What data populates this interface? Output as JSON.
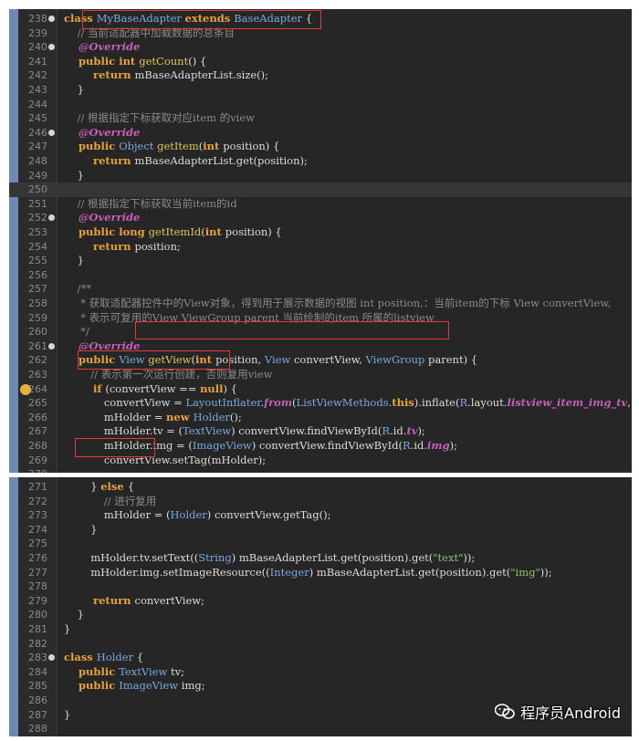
{
  "watermark": {
    "text": "程序员Android",
    "icon": "wechat-icon"
  },
  "editor1": {
    "lines": [
      {
        "n": "238",
        "fold": true,
        "segs": [
          [
            "k",
            "class "
          ],
          [
            "t",
            "MyBaseAdapter "
          ],
          [
            "k",
            "extends "
          ],
          [
            "t",
            "BaseAdapter "
          ],
          [
            "",
            "{"
          ]
        ]
      },
      {
        "n": "239",
        "segs": [
          [
            "c",
            "    // 当前适配器中加载数据的总条目"
          ]
        ]
      },
      {
        "n": "240",
        "fold": true,
        "segs": [
          [
            "a",
            "    @Override"
          ]
        ]
      },
      {
        "n": "241",
        "segs": [
          [
            "k",
            "    public int "
          ],
          [
            "m",
            "getCount"
          ],
          [
            "",
            "() {"
          ]
        ]
      },
      {
        "n": "242",
        "segs": [
          [
            "k",
            "        return "
          ],
          [
            "",
            "mBaseAdapterList.size();"
          ]
        ]
      },
      {
        "n": "243",
        "segs": [
          [
            "",
            "    }"
          ]
        ]
      },
      {
        "n": "244",
        "segs": [
          [
            "",
            ""
          ]
        ]
      },
      {
        "n": "245",
        "segs": [
          [
            "c",
            "    // 根据指定下标获取对应item 的view"
          ]
        ]
      },
      {
        "n": "246",
        "fold": true,
        "segs": [
          [
            "a",
            "    @Override"
          ]
        ]
      },
      {
        "n": "247",
        "segs": [
          [
            "k",
            "    public "
          ],
          [
            "t",
            "Object "
          ],
          [
            "m",
            "getItem"
          ],
          [
            "",
            "("
          ],
          [
            "k",
            "int "
          ],
          [
            "",
            "position) {"
          ]
        ]
      },
      {
        "n": "248",
        "segs": [
          [
            "k",
            "        return "
          ],
          [
            "",
            "mBaseAdapterList.get(position);"
          ]
        ]
      },
      {
        "n": "249",
        "segs": [
          [
            "",
            "    }"
          ]
        ]
      },
      {
        "n": "250",
        "hl": true,
        "segs": [
          [
            "",
            ""
          ]
        ]
      },
      {
        "n": "251",
        "segs": [
          [
            "c",
            "    // 根据指定下标获取当前item的id"
          ]
        ]
      },
      {
        "n": "252",
        "fold": true,
        "segs": [
          [
            "a",
            "    @Override"
          ]
        ]
      },
      {
        "n": "253",
        "segs": [
          [
            "k",
            "    public long "
          ],
          [
            "m",
            "getItemId"
          ],
          [
            "",
            "("
          ],
          [
            "k",
            "int "
          ],
          [
            "",
            "position) {"
          ]
        ]
      },
      {
        "n": "254",
        "segs": [
          [
            "k",
            "        return "
          ],
          [
            "",
            "position;"
          ]
        ]
      },
      {
        "n": "255",
        "segs": [
          [
            "",
            "    }"
          ]
        ]
      },
      {
        "n": "256",
        "segs": [
          [
            "",
            ""
          ]
        ]
      },
      {
        "n": "257",
        "segs": [
          [
            "c",
            "    /**"
          ]
        ]
      },
      {
        "n": "258",
        "segs": [
          [
            "c",
            "     * 获取适配器控件中的View对象，得到用于展示数据的视图 int position,：当前item的下标 View convertView,"
          ]
        ]
      },
      {
        "n": "259",
        "segs": [
          [
            "c",
            "     * 表示可复用的View ViewGroup parent 当前绘制的item 所属的listview"
          ]
        ]
      },
      {
        "n": "260",
        "segs": [
          [
            "c",
            "     */"
          ]
        ]
      },
      {
        "n": "261",
        "fold": true,
        "segs": [
          [
            "a",
            "    @Override"
          ]
        ]
      },
      {
        "n": "262",
        "segs": [
          [
            "k",
            "    public "
          ],
          [
            "t",
            "View "
          ],
          [
            "m",
            "getView"
          ],
          [
            "",
            "("
          ],
          [
            "k",
            "int "
          ],
          [
            "",
            "position, "
          ],
          [
            "t",
            "View "
          ],
          [
            "",
            "convertView, "
          ],
          [
            "t",
            "ViewGroup "
          ],
          [
            "",
            "parent) {"
          ]
        ]
      },
      {
        "n": "263",
        "segs": [
          [
            "c",
            "        // 表示第一次运行创建，否则复用view"
          ]
        ]
      },
      {
        "n": "264",
        "warn": true,
        "segs": [
          [
            "k",
            "        if "
          ],
          [
            "",
            "(convertView == "
          ],
          [
            "k",
            "null"
          ],
          [
            "",
            ") {"
          ]
        ]
      },
      {
        "n": "265",
        "segs": [
          [
            "",
            "            convertView = "
          ],
          [
            "t",
            "LayoutInflater"
          ],
          [
            "",
            "."
          ],
          [
            "a",
            "from"
          ],
          [
            "",
            "("
          ],
          [
            "t",
            "ListViewMethods"
          ],
          [
            "",
            "."
          ],
          [
            "k",
            "this"
          ],
          [
            "",
            ")."
          ],
          [
            "",
            "inflate("
          ],
          [
            "t",
            "R"
          ],
          [
            "",
            ".layout."
          ],
          [
            "a",
            "listview_item_img_tv"
          ],
          [
            "",
            ", "
          ],
          [
            "k",
            "null"
          ],
          [
            "",
            ");"
          ]
        ]
      },
      {
        "n": "266",
        "segs": [
          [
            "",
            "            mHolder = "
          ],
          [
            "k",
            "new "
          ],
          [
            "t",
            "Holder"
          ],
          [
            "",
            "();"
          ]
        ]
      },
      {
        "n": "267",
        "segs": [
          [
            "",
            "            mHolder.tv = ("
          ],
          [
            "t",
            "TextView"
          ],
          [
            "",
            ") convertView.findViewById("
          ],
          [
            "t",
            "R"
          ],
          [
            "",
            ".id."
          ],
          [
            "a",
            "tv"
          ],
          [
            "",
            ");"
          ]
        ]
      },
      {
        "n": "268",
        "segs": [
          [
            "",
            "            mHolder.img = ("
          ],
          [
            "t",
            "ImageView"
          ],
          [
            "",
            ") convertView.findViewById("
          ],
          [
            "t",
            "R"
          ],
          [
            "",
            ".id."
          ],
          [
            "a",
            "img"
          ],
          [
            "",
            ");"
          ]
        ]
      },
      {
        "n": "269",
        "segs": [
          [
            "",
            "            convertView.setTag(mHolder);"
          ]
        ]
      },
      {
        "n": "270",
        "segs": [
          [
            "",
            ""
          ]
        ]
      },
      {
        "n": "271",
        "segs": [
          [
            "",
            "        } "
          ],
          [
            "k",
            "else "
          ],
          [
            "",
            "{"
          ]
        ]
      },
      {
        "n": "272",
        "segs": [
          [
            "c",
            "            // 进行复用"
          ]
        ]
      }
    ]
  },
  "editor2": {
    "lines": [
      {
        "n": "271",
        "segs": [
          [
            "",
            "        } "
          ],
          [
            "k",
            "else "
          ],
          [
            "",
            "{"
          ]
        ]
      },
      {
        "n": "272",
        "segs": [
          [
            "c",
            "            // 进行复用"
          ]
        ]
      },
      {
        "n": "273",
        "segs": [
          [
            "",
            "            mHolder = ("
          ],
          [
            "t",
            "Holder"
          ],
          [
            "",
            ") convertView.getTag();"
          ]
        ]
      },
      {
        "n": "274",
        "segs": [
          [
            "",
            "        }"
          ]
        ]
      },
      {
        "n": "275",
        "segs": [
          [
            "",
            ""
          ]
        ]
      },
      {
        "n": "276",
        "segs": [
          [
            "",
            "        mHolder.tv.setText(("
          ],
          [
            "t",
            "String"
          ],
          [
            "",
            ") mBaseAdapterList.get(position).get("
          ],
          [
            "s",
            "\"text\""
          ],
          [
            "",
            "));"
          ]
        ]
      },
      {
        "n": "277",
        "segs": [
          [
            "",
            "        mHolder.img.setImageResource(("
          ],
          [
            "t",
            "Integer"
          ],
          [
            "",
            ") mBaseAdapterList.get(position).get("
          ],
          [
            "s",
            "\"img\""
          ],
          [
            "",
            "));"
          ]
        ]
      },
      {
        "n": "278",
        "segs": [
          [
            "",
            ""
          ]
        ]
      },
      {
        "n": "279",
        "segs": [
          [
            "k",
            "        return "
          ],
          [
            "",
            "convertView;"
          ]
        ]
      },
      {
        "n": "280",
        "segs": [
          [
            "",
            "    }"
          ]
        ]
      },
      {
        "n": "281",
        "segs": [
          [
            "",
            "}"
          ]
        ]
      },
      {
        "n": "282",
        "segs": [
          [
            "",
            ""
          ]
        ]
      },
      {
        "n": "283",
        "fold": true,
        "segs": [
          [
            "k",
            "class "
          ],
          [
            "t",
            "Holder "
          ],
          [
            "",
            "{"
          ]
        ]
      },
      {
        "n": "284",
        "segs": [
          [
            "k",
            "    public "
          ],
          [
            "t",
            "TextView "
          ],
          [
            "",
            "tv;"
          ]
        ]
      },
      {
        "n": "285",
        "segs": [
          [
            "k",
            "    public "
          ],
          [
            "t",
            "ImageView "
          ],
          [
            "",
            "img;"
          ]
        ]
      },
      {
        "n": "286",
        "segs": [
          [
            "",
            ""
          ]
        ]
      },
      {
        "n": "287",
        "segs": [
          [
            "",
            "}"
          ]
        ]
      },
      {
        "n": "288",
        "segs": [
          [
            "",
            ""
          ]
        ]
      }
    ]
  }
}
